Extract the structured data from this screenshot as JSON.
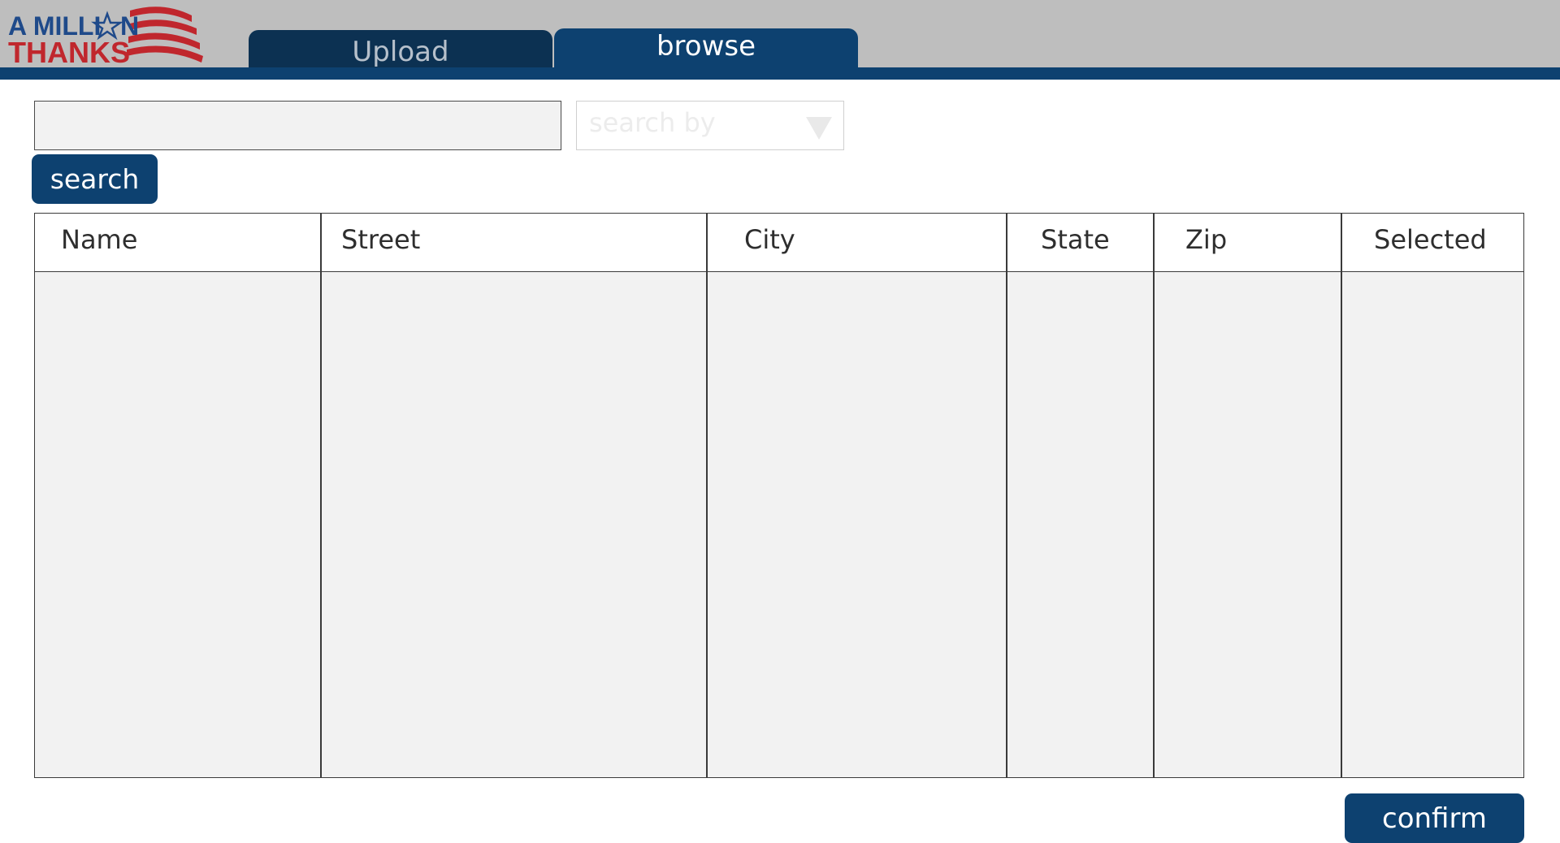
{
  "logo": {
    "line1": "A MILLI",
    "line1_end": "N",
    "line2": "THANKS"
  },
  "tabs": [
    {
      "label": "Upload",
      "active": false
    },
    {
      "label": "browse",
      "active": true
    }
  ],
  "search": {
    "input_value": "",
    "input_placeholder": "",
    "search_by_placeholder": "search by",
    "button_label": "search"
  },
  "table": {
    "columns": [
      "Name",
      "Street",
      "City",
      "State",
      "Zip",
      "Selected"
    ],
    "rows": []
  },
  "footer": {
    "confirm_label": "confirm"
  },
  "colors": {
    "header_bg": "#bebebe",
    "brand_navy": "#0d4170",
    "logo_red": "#c0272d",
    "logo_blue": "#1f4a8a"
  }
}
